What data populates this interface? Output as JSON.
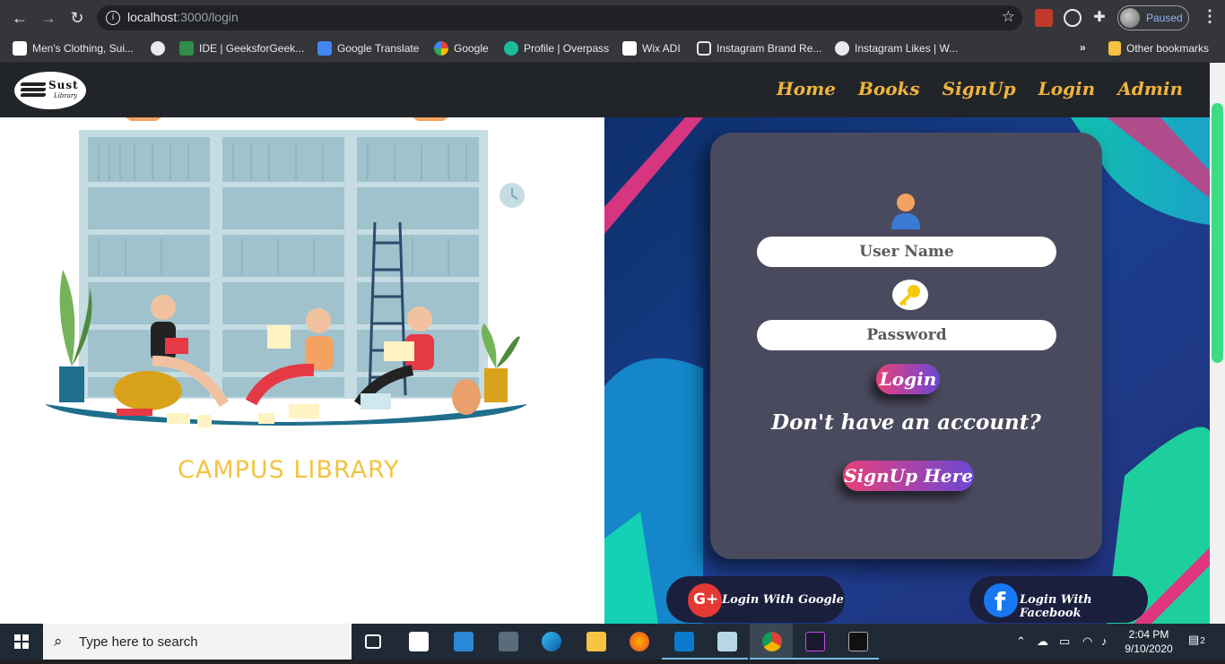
{
  "browser": {
    "url_host": "localhost",
    "url_path": ":3000/login",
    "profile_status": "Paused",
    "bookmarks": [
      {
        "label": "Men's Clothing, Sui..."
      },
      {
        "label": ""
      },
      {
        "label": "IDE | GeeksforGeek..."
      },
      {
        "label": "Google Translate"
      },
      {
        "label": "Google"
      },
      {
        "label": "Profile | Overpass"
      },
      {
        "label": "Wix ADI"
      },
      {
        "label": "Instagram Brand Re..."
      },
      {
        "label": "Instagram Likes | W..."
      }
    ],
    "overflow": "»",
    "other_bookmarks": "Other bookmarks"
  },
  "navbar": {
    "logo_title": "Sust",
    "logo_subtitle": "Library",
    "links": [
      "Home",
      "Books",
      "SignUp",
      "Login",
      "Admin"
    ]
  },
  "hero": {
    "caption": "CAMPUS LIBRARY"
  },
  "login_form": {
    "username_placeholder": "User Name",
    "password_placeholder": "Password",
    "login_button": "Login",
    "no_account_text": "Don't have an account?",
    "signup_button": "SignUp Here"
  },
  "social": {
    "google": "Login With Google",
    "facebook": "Login With Facebook"
  },
  "taskbar": {
    "search_placeholder": "Type here to search",
    "time": "2:04 PM",
    "date": "9/10/2020",
    "notifications": "2"
  },
  "colors": {
    "accent": "#f0b43c",
    "navbar_bg": "#212529",
    "card_bg": "#4a4a5e",
    "button_gradient_start": "#e8407a",
    "button_gradient_end": "#6b47d4",
    "campus_text": "#f3c341"
  }
}
